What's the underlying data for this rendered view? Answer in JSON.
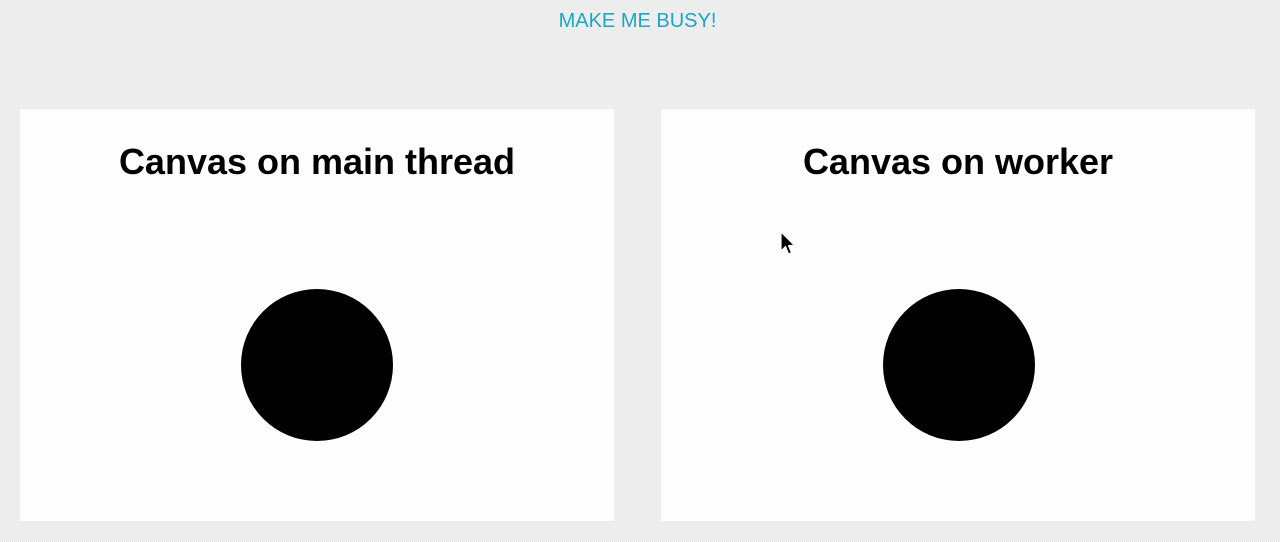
{
  "toolbar": {
    "busy_label": "MAKE ME BUSY!"
  },
  "panels": [
    {
      "title": "Canvas on main thread"
    },
    {
      "title": "Canvas on worker"
    }
  ],
  "colors": {
    "accent": "#1aa6c7",
    "ball": "#000000",
    "panel_bg": "#fdfdfd"
  },
  "icons": {
    "cursor": "mouse-pointer-icon"
  }
}
